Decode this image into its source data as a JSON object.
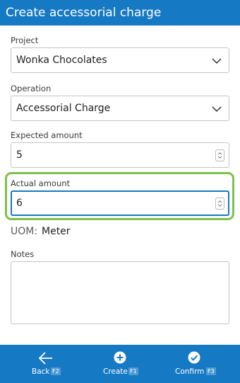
{
  "header": {
    "title": "Create accessorial charge"
  },
  "form": {
    "project": {
      "label": "Project",
      "value": "Wonka Chocolates"
    },
    "operation": {
      "label": "Operation",
      "value": "Accessorial Charge"
    },
    "expected": {
      "label": "Expected amount",
      "value": "5"
    },
    "actual": {
      "label": "Actual amount",
      "value": "6"
    },
    "uom": {
      "label": "UOM:",
      "value": "Meter"
    },
    "notes": {
      "label": "Notes",
      "value": ""
    }
  },
  "footer": {
    "back": {
      "label": "Back",
      "key": "F2",
      "icon": "arrow-left-icon"
    },
    "create": {
      "label": "Create",
      "key": "F1",
      "icon": "plus-circle-icon"
    },
    "confirm": {
      "label": "Confirm",
      "key": "F3",
      "icon": "check-circle-icon"
    }
  },
  "colors": {
    "header": "#1679c3",
    "footer": "#1679c3",
    "focus_ring": "#7dc14c",
    "focus_border": "#1679c3"
  }
}
